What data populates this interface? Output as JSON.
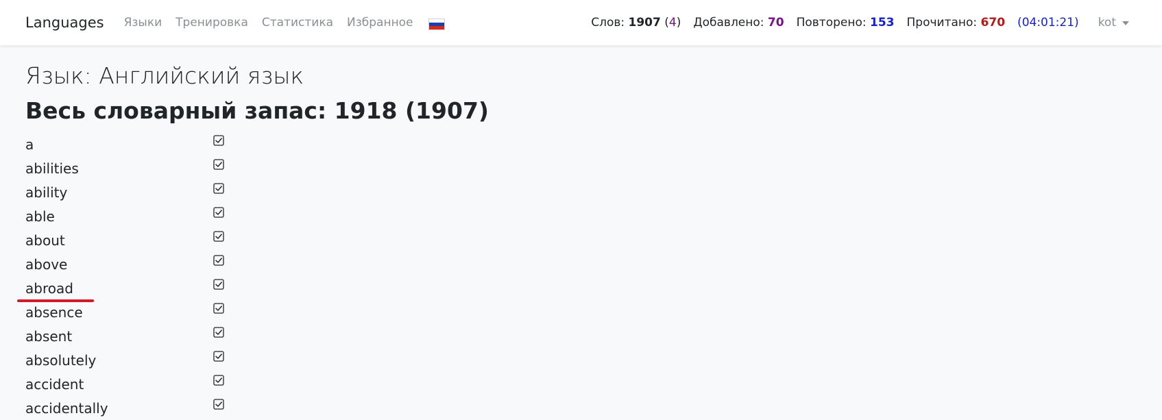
{
  "navbar": {
    "brand": "Languages",
    "links": [
      "Языки",
      "Тренировка",
      "Статистика",
      "Избранное"
    ],
    "flag_icon": "russian-flag-icon",
    "flag_colors": [
      "#ffffff",
      "#1c3fa8",
      "#d52b1e"
    ]
  },
  "stats": {
    "words_label": "Слов:",
    "words_total": "1907",
    "words_extra": "4",
    "added_label": "Добавлено:",
    "added_value": "70",
    "repeated_label": "Повторено:",
    "repeated_value": "153",
    "read_label": "Прочитано:",
    "read_value": "670",
    "timer": "04:01:21",
    "colors": {
      "purple": "#7a0f8f",
      "blue": "#1422c8",
      "red": "#b31b1b"
    }
  },
  "user": {
    "name": "kot",
    "icon": "caret-down-icon"
  },
  "main": {
    "language_title": "Язык: Английский язык",
    "vocabulary_title": "Весь словарный запас: 1918 (1907)",
    "words": [
      {
        "word": "a",
        "checked": true
      },
      {
        "word": "abilities",
        "checked": true
      },
      {
        "word": "ability",
        "checked": true
      },
      {
        "word": "able",
        "checked": true
      },
      {
        "word": "about",
        "checked": true
      },
      {
        "word": "above",
        "checked": true
      },
      {
        "word": "abroad",
        "checked": true
      },
      {
        "word": "absence",
        "checked": true
      },
      {
        "word": "absent",
        "checked": true
      },
      {
        "word": "absolutely",
        "checked": true
      },
      {
        "word": "accident",
        "checked": true
      },
      {
        "word": "accidentally",
        "checked": true
      }
    ],
    "check_icon": "checkbox-checked-icon",
    "highlight_color": "#d21a2a"
  }
}
